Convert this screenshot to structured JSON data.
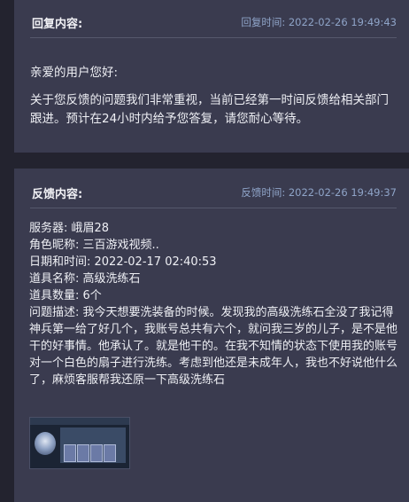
{
  "reply": {
    "title": "回复内容:",
    "time": "回复时间: 2022-02-26 19:49:43",
    "greeting": "亲爱的用户您好:",
    "message": "关于您反馈的问题我们非常重视，当前已经第一时间反馈给相关部门跟进。预计在24小时内给予您答复，请您耐心等待。"
  },
  "feedback": {
    "title": "反馈内容:",
    "time": "反馈时间: 2022-02-26 19:49:37",
    "server": "服务器: 峨眉28",
    "nickname": "角色昵称: 三百游戏视频..",
    "datetime": "日期和时间: 2022-02-17 02:40:53",
    "item_name": "道具名称: 高级洗练石",
    "item_count": "道具数量: 6个",
    "description": "问题描述: 我今天想要洗装备的时候。发现我的高级洗练石全没了我记得神兵第一给了好几个，我账号总共有六个，就问我三岁的儿子，是不是他干的好事情。他承认了。就是他干的。在我不知情的状态下使用我的账号对一个白色的扇子进行洗练。考虑到他还是未成年人，我也不好说他什么了，麻烦客服帮我还原一下高级洗练石"
  }
}
